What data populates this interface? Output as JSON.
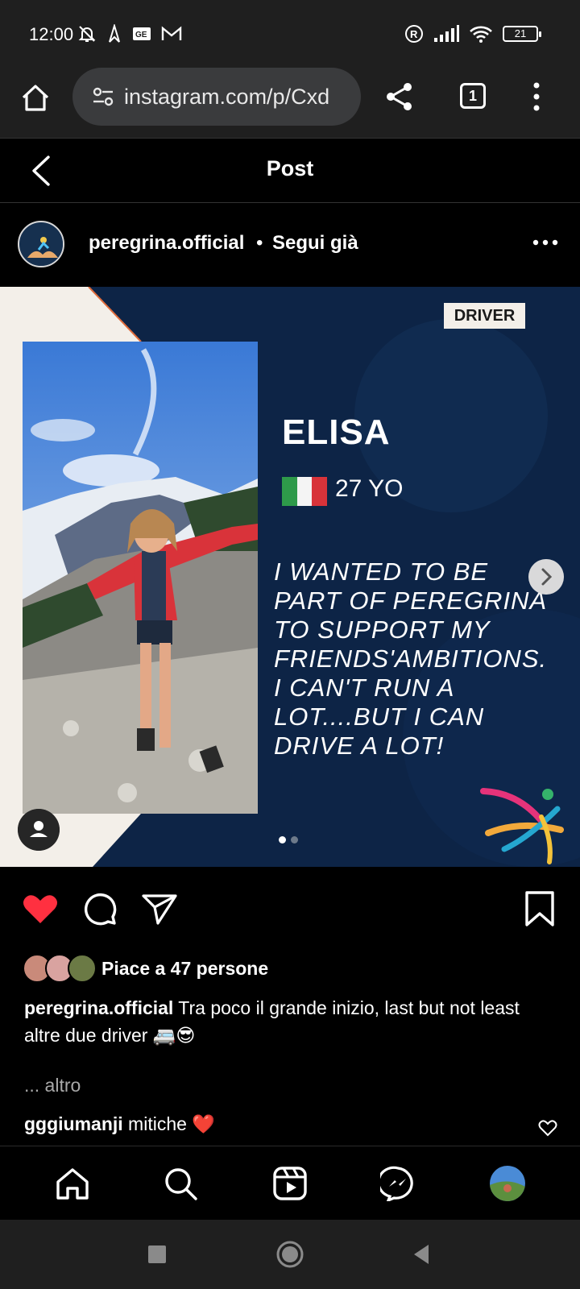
{
  "status_bar": {
    "time": "12:00",
    "battery": "21",
    "icons": [
      "mute-icon",
      "navigation-icon",
      "ge-icon",
      "gmail-icon",
      "registered-icon",
      "signal-icon",
      "wifi-icon",
      "battery-icon"
    ]
  },
  "browser": {
    "url": "instagram.com/p/Cxd",
    "tab_count": "1"
  },
  "header": {
    "title": "Post"
  },
  "post": {
    "username": "peregrina.official",
    "separator": "•",
    "follow_status": "Segui già"
  },
  "slide": {
    "tag": "DRIVER",
    "name": "ELISA",
    "age": "27 YO",
    "quote_lines": [
      "I WANTED TO BE",
      "PART OF PEREGRINA",
      "TO SUPPORT MY",
      "FRIENDS'AMBITIONS.",
      "I CAN'T RUN A",
      "LOT....BUT I CAN",
      "DRIVE A LOT!"
    ],
    "current_slide": 1,
    "total_slides": 2
  },
  "likes": {
    "text": "Piace a 47 persone"
  },
  "caption": {
    "username": "peregrina.official",
    "text": " Tra poco il grande inizio, last but not least altre due driver 🚐😎",
    "more": "... altro"
  },
  "comment": {
    "username": "gggiumanji",
    "text": " mitiche ❤️"
  },
  "colors": {
    "like_red": "#ff3040",
    "slide_navy": "#0d2446",
    "cream": "#f3efe9"
  }
}
